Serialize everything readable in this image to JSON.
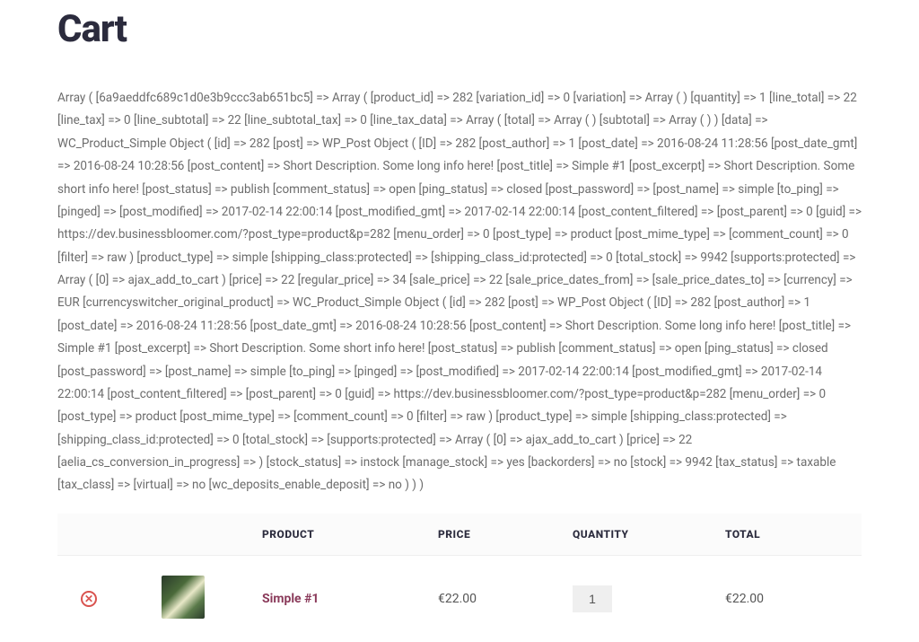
{
  "page": {
    "title": "Cart"
  },
  "dump": "Array ( [6a9aeddfc689c1d0e3b9ccc3ab651bc5] => Array ( [product_id] => 282 [variation_id] => 0 [variation] => Array ( ) [quantity] => 1 [line_total] => 22 [line_tax] => 0 [line_subtotal] => 22 [line_subtotal_tax] => 0 [line_tax_data] => Array ( [total] => Array ( ) [subtotal] => Array ( ) ) [data] => WC_Product_Simple Object ( [id] => 282 [post] => WP_Post Object ( [ID] => 282 [post_author] => 1 [post_date] => 2016-08-24 11:28:56 [post_date_gmt] => 2016-08-24 10:28:56 [post_content] => Short Description. Some long info here! [post_title] => Simple #1 [post_excerpt] => Short Description. Some short info here! [post_status] => publish [comment_status] => open [ping_status] => closed [post_password] => [post_name] => simple [to_ping] => [pinged] => [post_modified] => 2017-02-14 22:00:14 [post_modified_gmt] => 2017-02-14 22:00:14 [post_content_filtered] => [post_parent] => 0 [guid] => https://dev.businessbloomer.com/?post_type=product&p=282 [menu_order] => 0 [post_type] => product [post_mime_type] => [comment_count] => 0 [filter] => raw ) [product_type] => simple [shipping_class:protected] => [shipping_class_id:protected] => 0 [total_stock] => 9942 [supports:protected] => Array ( [0] => ajax_add_to_cart ) [price] => 22 [regular_price] => 34 [sale_price] => 22 [sale_price_dates_from] => [sale_price_dates_to] => [currency] => EUR [currencyswitcher_original_product] => WC_Product_Simple Object ( [id] => 282 [post] => WP_Post Object ( [ID] => 282 [post_author] => 1 [post_date] => 2016-08-24 11:28:56 [post_date_gmt] => 2016-08-24 10:28:56 [post_content] => Short Description. Some long info here! [post_title] => Simple #1 [post_excerpt] => Short Description. Some short info here! [post_status] => publish [comment_status] => open [ping_status] => closed [post_password] => [post_name] => simple [to_ping] => [pinged] => [post_modified] => 2017-02-14 22:00:14 [post_modified_gmt] => 2017-02-14 22:00:14 [post_content_filtered] => [post_parent] => 0 [guid] => https://dev.businessbloomer.com/?post_type=product&p=282 [menu_order] => 0 [post_type] => product [post_mime_type] => [comment_count] => 0 [filter] => raw ) [product_type] => simple [shipping_class:protected] => [shipping_class_id:protected] => 0 [total_stock] => [supports:protected] => Array ( [0] => ajax_add_to_cart ) [price] => 22 [aelia_cs_conversion_in_progress] => ) [stock_status] => instock [manage_stock] => yes [backorders] => no [stock] => 9942 [tax_status] => taxable [tax_class] => [virtual] => no [wc_deposits_enable_deposit] => no ) ) )",
  "cart": {
    "headers": {
      "product": "PRODUCT",
      "price": "PRICE",
      "quantity": "QUANTITY",
      "total": "TOTAL"
    },
    "items": [
      {
        "remove_symbol": "✕",
        "product_name": "Simple #1",
        "price": "€22.00",
        "quantity": "1",
        "total": "€22.00"
      }
    ]
  }
}
